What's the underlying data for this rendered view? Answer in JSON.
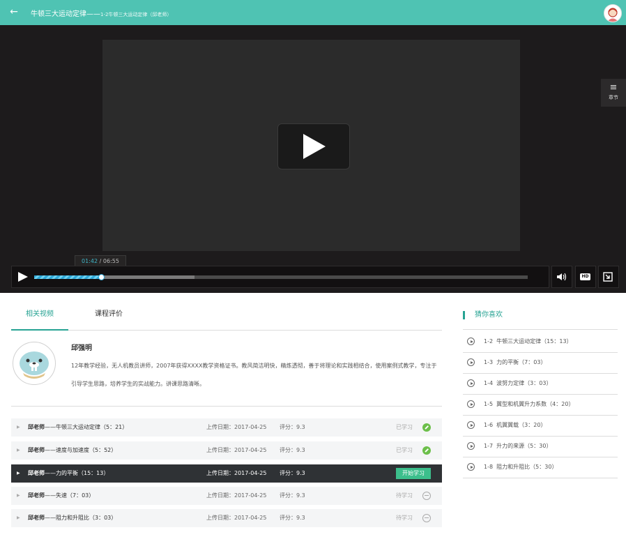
{
  "header": {
    "title": "牛顿三大运动定律——",
    "subtitle": "1-2牛顿三大运动定律（邱老师）"
  },
  "player": {
    "chapter_label": "章节",
    "current_time": "01:42",
    "separator": " / ",
    "duration": "06:55",
    "progress": 0.135,
    "buffered": 0.325,
    "hd_label": "HD"
  },
  "tabs": [
    {
      "label": "相关视频",
      "active": true
    },
    {
      "label": "课程评价",
      "active": false
    }
  ],
  "teacher": {
    "name": "邱强明",
    "description": "12年教学经验，无人机教员讲师，2007年获得XXXX教学资格证书。教风简洁明快，精炼透彻，善于将理论和实践相结合，使用案例式教学，专注于引导学生思路，培养学生的实战能力。讲课思路清晰。"
  },
  "lessons": [
    {
      "teacher": "邱老师",
      "title": "——牛顿三大运动定律（5：21）",
      "date": "上传日期：2017-04-25",
      "score": "评分：9.3",
      "status": "已学习",
      "state": "done"
    },
    {
      "teacher": "邱老师",
      "title": "——速度与加速度（5：52）",
      "date": "上传日期：2017-04-25",
      "score": "评分：9.3",
      "status": "已学习",
      "state": "done"
    },
    {
      "teacher": "邱老师",
      "title": "——力的平衡（15：13）",
      "date": "上传日期：2017-04-25",
      "score": "评分：9.3",
      "status": "开始学习",
      "state": "current"
    },
    {
      "teacher": "邱老师",
      "title": "——失速（7：03）",
      "date": "上传日期：2017-04-25",
      "score": "评分：9.3",
      "status": "待学习",
      "state": "pending"
    },
    {
      "teacher": "邱老师",
      "title": "——阻力和升阻比（3：03）",
      "date": "上传日期：2017-04-25",
      "score": "评分：9.3",
      "status": "待学习",
      "state": "pending"
    }
  ],
  "sidebar": {
    "heading": "猜你喜欢",
    "items": [
      {
        "num": "1-2",
        "title": "牛顿三大运动定律（15：13）"
      },
      {
        "num": "1-3",
        "title": "力的平衡（7：03）"
      },
      {
        "num": "1-4",
        "title": "波努力定律（3：03）"
      },
      {
        "num": "1-5",
        "title": "翼型和机翼升力系数（4：20）"
      },
      {
        "num": "1-6",
        "title": "机翼翼载（3：20）"
      },
      {
        "num": "1-7",
        "title": "升力的来源（5：30）"
      },
      {
        "num": "1-8",
        "title": "阻力和升阻比（5：30）"
      }
    ]
  },
  "colors": {
    "accent": "#4fc3b3",
    "tab_active": "#27a393",
    "progress": "#2fa8d8",
    "start_button": "#3cbf8c",
    "done_icon": "#6cbf4a"
  }
}
